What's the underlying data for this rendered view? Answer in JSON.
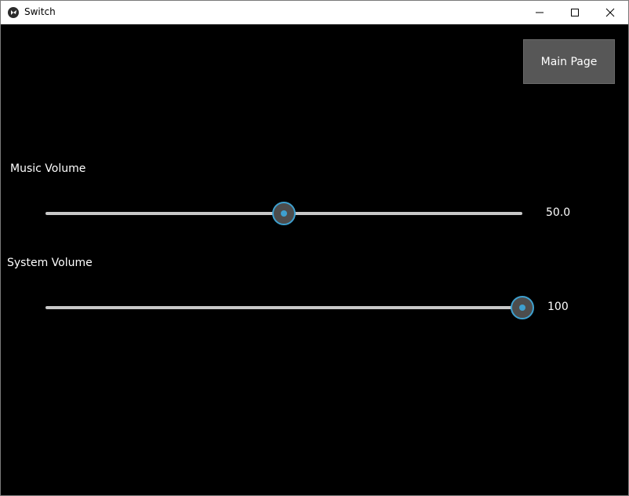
{
  "window": {
    "title": "Switch",
    "app_icon": "kivy-logo-icon",
    "controls": [
      "minimize-icon",
      "maximize-icon",
      "close-icon"
    ]
  },
  "main_page_button": {
    "label": "Main Page"
  },
  "music": {
    "label": "Music Volume",
    "value_text": "50.0",
    "value": 50,
    "min": 0,
    "max": 100
  },
  "system": {
    "label": "System Volume",
    "value_text": "100",
    "value": 100,
    "min": 0,
    "max": 100
  },
  "colors": {
    "background": "#000000",
    "accent": "#3ea0cf",
    "track": "#c8c8c8",
    "button": "#575757"
  }
}
